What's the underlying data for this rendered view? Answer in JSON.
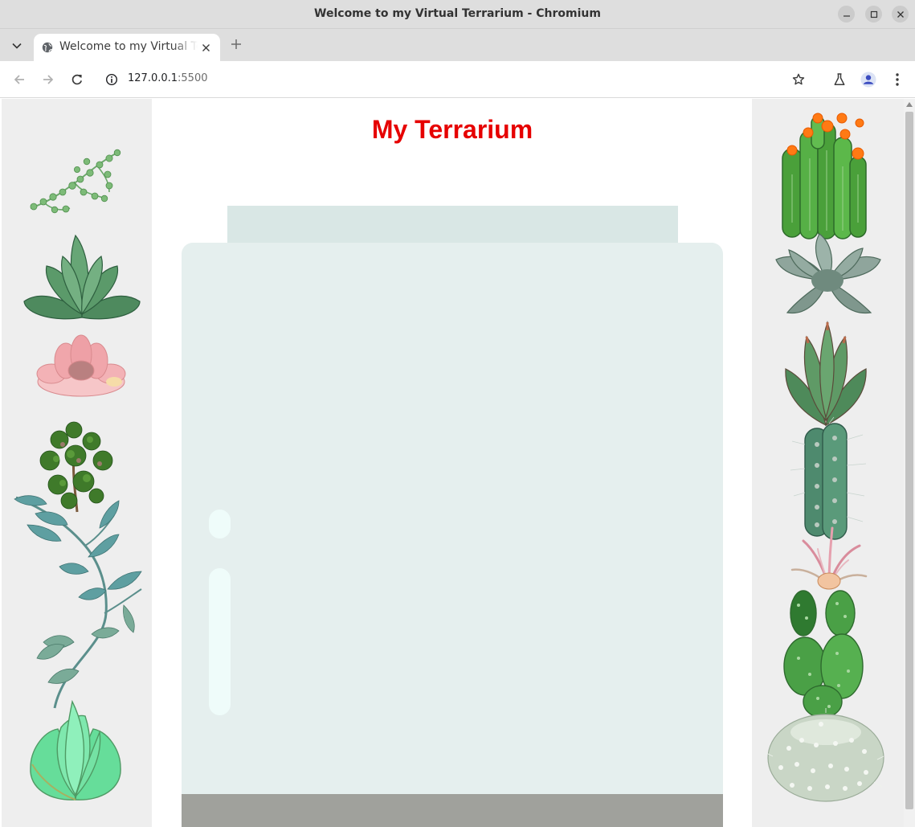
{
  "window": {
    "title": "Welcome to my Virtual Terrarium - Chromium",
    "controls": [
      "minimize-icon",
      "maximize-icon",
      "close-icon"
    ]
  },
  "tabs": [
    {
      "label": "Welcome to my Virtual Terrarium",
      "icon": "globe-icon",
      "active": true
    }
  ],
  "toolbar": {
    "url_host": "127.0.0.1",
    "url_port": ":5500",
    "icons": [
      "back-icon",
      "forward-icon",
      "reload-icon",
      "site-info-icon",
      "bookmark-star-icon",
      "labs-flask-icon",
      "profile-avatar-icon",
      "menu-kebab-icon"
    ]
  },
  "page": {
    "heading": "My Terrarium",
    "heading_color": "#e60000",
    "left_plants": [
      "plant1",
      "plant2",
      "plant3",
      "plant4",
      "plant5",
      "plant6",
      "plant7"
    ],
    "right_plants": [
      "plant8",
      "plant9",
      "plant10",
      "plant11",
      "plant12",
      "plant13",
      "plant14"
    ],
    "jar_colors": {
      "top": "#d9e7e5",
      "body": "#e5efee",
      "glossy": "#effcfa",
      "bottom": "#a0a19c"
    },
    "side_panel_color": "#eeeeee"
  }
}
